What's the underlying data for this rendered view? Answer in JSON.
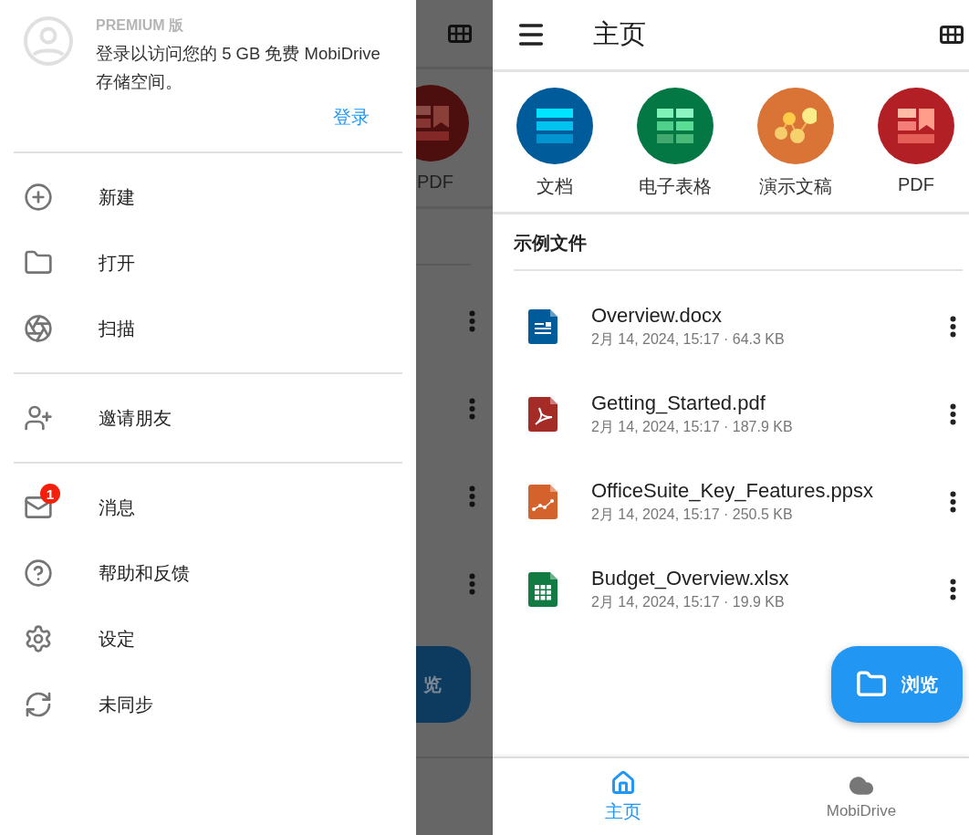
{
  "drawer": {
    "account": {
      "edition": "PREMIUM 版",
      "message": "登录以访问您的 5 GB 免费 MobiDrive 存储空间。",
      "sign_in": "登录"
    },
    "sections": [
      {
        "items": [
          {
            "label": "新建"
          },
          {
            "label": "打开"
          },
          {
            "label": "扫描"
          }
        ]
      },
      {
        "items": [
          {
            "label": "邀请朋友"
          }
        ]
      },
      {
        "items": [
          {
            "label": "消息",
            "badge": "1"
          },
          {
            "label": "帮助和反馈"
          },
          {
            "label": "设定"
          },
          {
            "label": "未同步"
          }
        ]
      }
    ]
  },
  "backdrop": {
    "category_label": "PDF",
    "fab_label": "览"
  },
  "home": {
    "title": "主页",
    "categories": [
      {
        "kind": "document",
        "label": "文档",
        "color": "#005b9a"
      },
      {
        "kind": "spreadsheet",
        "label": "电子表格",
        "color": "#037744"
      },
      {
        "kind": "presentation",
        "label": "演示文稿",
        "color": "#d97436"
      },
      {
        "kind": "pdf",
        "label": "PDF",
        "color": "#b21f24"
      }
    ],
    "section_title": "示例文件",
    "files": [
      {
        "kind": "document",
        "name": "Overview.docx",
        "meta": "2月 14, 2024, 15:17 · 64.3 KB"
      },
      {
        "kind": "pdf",
        "name": "Getting_Started.pdf",
        "meta": "2月 14, 2024, 15:17 · 187.9 KB"
      },
      {
        "kind": "presentation",
        "name": "OfficeSuite_Key_Features.ppsx",
        "meta": "2月 14, 2024, 15:17 · 250.5 KB"
      },
      {
        "kind": "spreadsheet",
        "name": "Budget_Overview.xlsx",
        "meta": "2月 14, 2024, 15:17 · 19.9 KB"
      }
    ],
    "fab": {
      "label": "浏览"
    },
    "nav": [
      {
        "label": "主页",
        "selected": true
      },
      {
        "label": "MobiDrive",
        "selected": false
      }
    ]
  }
}
